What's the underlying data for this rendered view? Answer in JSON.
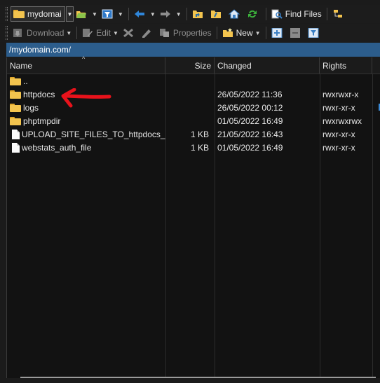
{
  "toolbar1": {
    "drive_label": "mydomai",
    "find_files_label": "Find Files"
  },
  "toolbar2": {
    "download_label": "Download",
    "edit_label": "Edit",
    "properties_label": "Properties",
    "new_label": "New"
  },
  "path": "/mydomain.com/",
  "columns": {
    "name": "Name",
    "size": "Size",
    "changed": "Changed",
    "rights": "Rights"
  },
  "rows": [
    {
      "name": "..",
      "type": "parent",
      "size": "",
      "changed": "",
      "rights": ""
    },
    {
      "name": "httpdocs",
      "type": "folder",
      "size": "",
      "changed": "26/05/2022 11:36",
      "rights": "rwxrwxr-x"
    },
    {
      "name": "logs",
      "type": "folder",
      "size": "",
      "changed": "26/05/2022 00:12",
      "rights": "rwxr-xr-x"
    },
    {
      "name": "phptmpdir",
      "type": "folder",
      "size": "",
      "changed": "01/05/2022 16:49",
      "rights": "rwxrwxrwx"
    },
    {
      "name": "UPLOAD_SITE_FILES_TO_httpdocs_F...",
      "type": "file",
      "size": "1 KB",
      "changed": "21/05/2022 16:43",
      "rights": "rwxr-xr-x"
    },
    {
      "name": "webstats_auth_file",
      "type": "file",
      "size": "1 KB",
      "changed": "01/05/2022 16:49",
      "rights": "rwxr-xr-x"
    }
  ],
  "colors": {
    "path_bar": "#2c5d8c",
    "folder": "#f3c44e",
    "annotation_arrow": "#e8121b"
  },
  "icons": [
    "folder-icon",
    "open-folder-icon",
    "filter-icon",
    "back-arrow-icon",
    "forward-arrow-icon",
    "parent-dir-icon",
    "root-dir-icon",
    "home-icon",
    "refresh-icon",
    "find-files-icon",
    "tree-icon",
    "download-icon",
    "edit-icon",
    "delete-icon",
    "properties-icon",
    "new-icon",
    "plus-icon",
    "minus-icon",
    "select-filter-icon",
    "file-icon",
    "red-arrow-annotation"
  ]
}
